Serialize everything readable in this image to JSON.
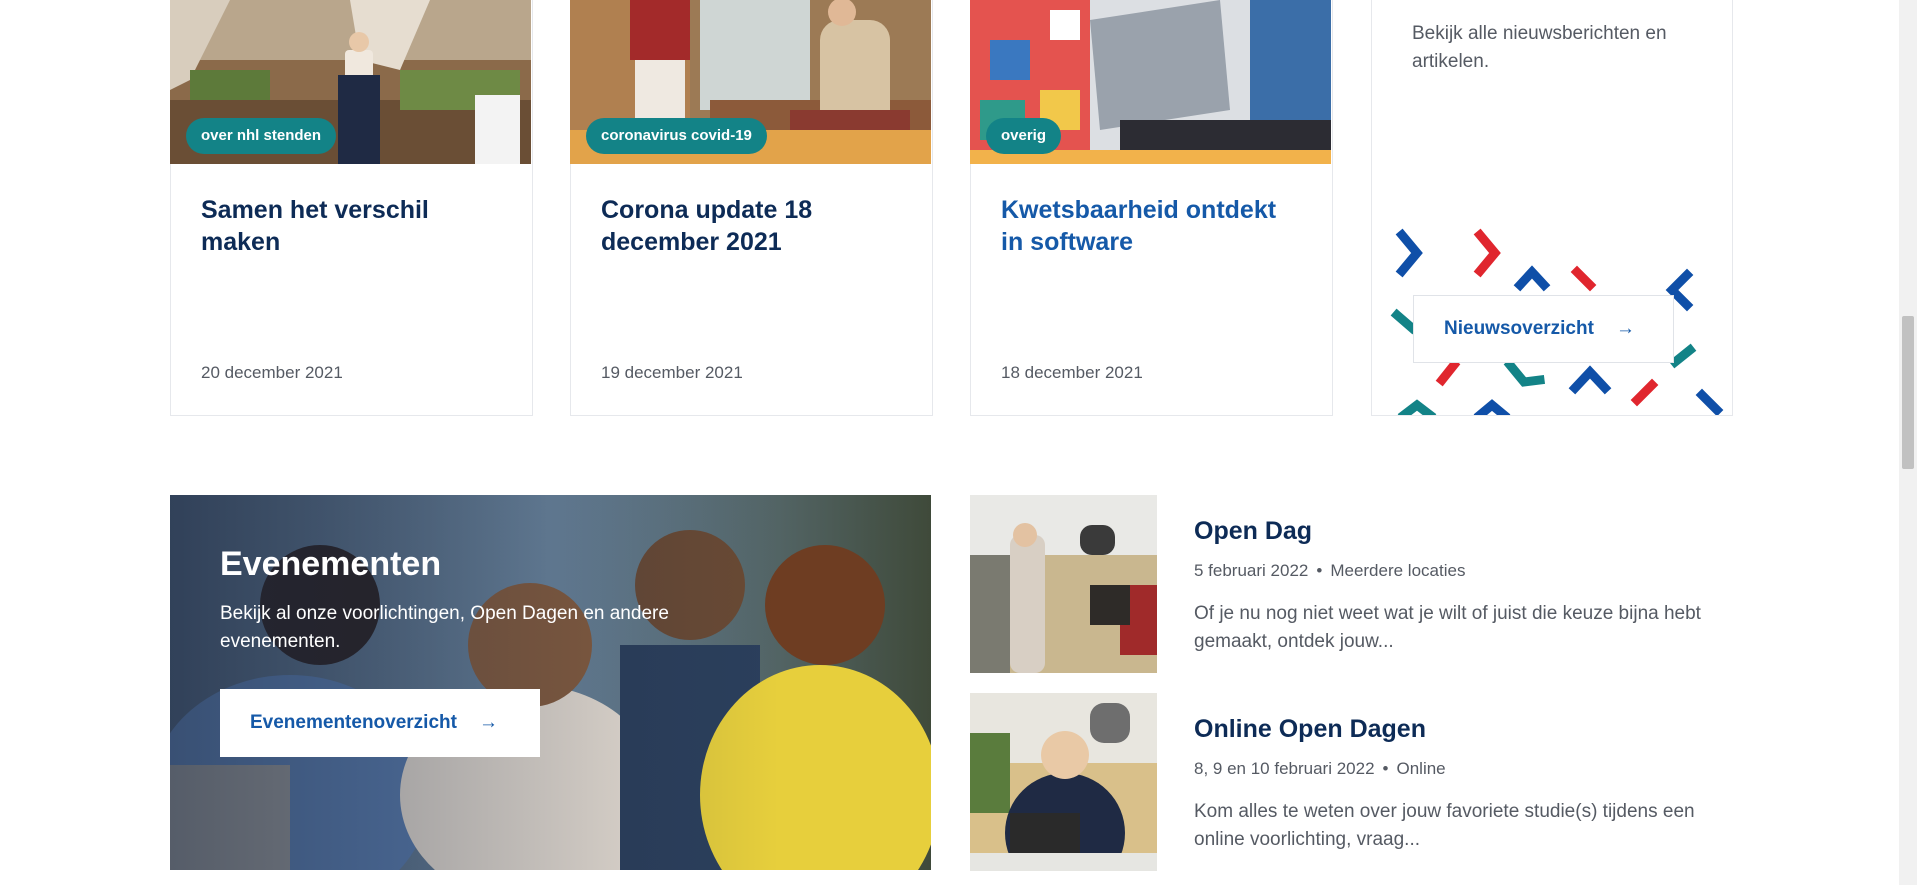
{
  "news": [
    {
      "tag": "over nhl stenden",
      "title": "Samen het verschil maken",
      "date": "20 december 2021"
    },
    {
      "tag": "coronavirus covid-19",
      "title": "Corona update 18 december 2021",
      "date": "19 december 2021"
    },
    {
      "tag": "overig",
      "title": "Kwetsbaarheid ontdekt in software",
      "date": "18 december 2021"
    }
  ],
  "overview": {
    "text": "Bekijk alle nieuwsberichten en artikelen.",
    "button_label": "Nieuwsoverzicht",
    "arrow": "→"
  },
  "events": {
    "title": "Evenementen",
    "description": "Bekijk al onze voorlichtingen, Open Dagen en andere evenementen.",
    "button_label": "Evenementenoverzicht",
    "arrow": "→"
  },
  "event_list": [
    {
      "title": "Open Dag",
      "date": "5 februari 2022",
      "location": "Meerdere locaties",
      "description": "Of je nu nog niet weet wat je wilt of juist die keuze bijna hebt gemaakt, ontdek jouw..."
    },
    {
      "title": "Online Open Dagen",
      "date": "8, 9 en 10 februari 2022",
      "location": "Online",
      "description": "Kom alles te weten over jouw favoriete studie(s) tijdens een online voorlichting, vraag..."
    }
  ],
  "separator": "•",
  "colors": {
    "navy": "#0d2b56",
    "link_blue": "#1559a8",
    "teal": "#138387",
    "red": "#e0262e",
    "chevron_blue": "#0f4fa8"
  }
}
